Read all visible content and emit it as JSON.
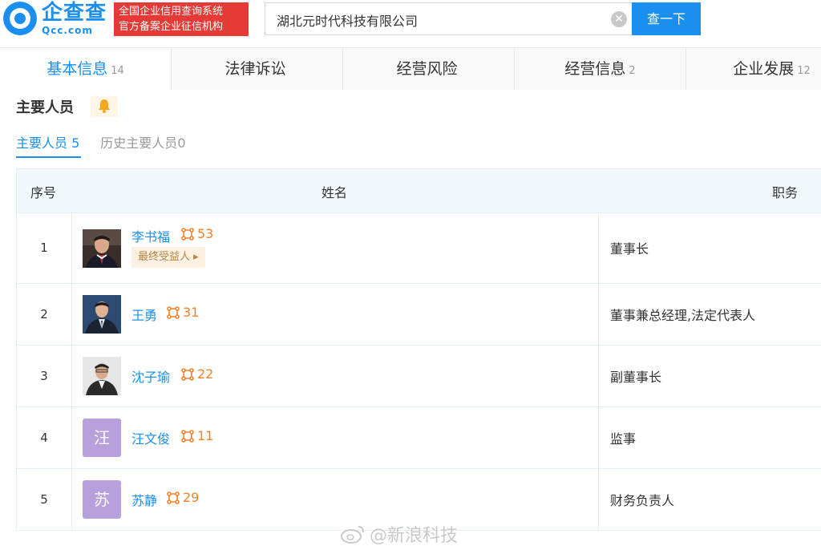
{
  "header": {
    "logo_cn": "企查查",
    "logo_en": "Qcc.com",
    "badge_line1": "全国企业信用查询系统",
    "badge_line2": "官方备案企业征信机构",
    "search_value": "湖北元时代科技有限公司",
    "search_button": "查一下"
  },
  "tabs": [
    {
      "label": "基本信息",
      "count": "14"
    },
    {
      "label": "法律诉讼",
      "count": ""
    },
    {
      "label": "经营风险",
      "count": ""
    },
    {
      "label": "经营信息",
      "count": "2"
    },
    {
      "label": "企业发展",
      "count": "12"
    }
  ],
  "section": {
    "title": "主要人员",
    "subtab_current": "主要人员",
    "subtab_current_count": "5",
    "subtab_history": "历史主要人员",
    "subtab_history_count": "0"
  },
  "table": {
    "col_index": "序号",
    "col_name": "姓名",
    "col_role": "职务",
    "rows": [
      {
        "index": "1",
        "name": "李书福",
        "relations": "53",
        "role": "董事长",
        "tag": "最终受益人",
        "avatar_text": ""
      },
      {
        "index": "2",
        "name": "王勇",
        "relations": "31",
        "role": "董事兼总经理,法定代表人",
        "tag": "",
        "avatar_text": ""
      },
      {
        "index": "3",
        "name": "沈子瑜",
        "relations": "22",
        "role": "副董事长",
        "tag": "",
        "avatar_text": ""
      },
      {
        "index": "4",
        "name": "汪文俊",
        "relations": "11",
        "role": "监事",
        "tag": "",
        "avatar_text": "汪"
      },
      {
        "index": "5",
        "name": "苏静",
        "relations": "29",
        "role": "财务负责人",
        "tag": "",
        "avatar_text": "苏"
      }
    ]
  },
  "watermark": "@新浪科技",
  "colors": {
    "brand_blue": "#1a8ff0",
    "badge_red": "#e63a37",
    "relation_orange": "#f0812b",
    "avatar_purple": "#b8a0dc"
  },
  "icons": [
    "logo-icon",
    "clear-icon",
    "bell-icon",
    "relation-icon",
    "weibo-icon"
  ]
}
